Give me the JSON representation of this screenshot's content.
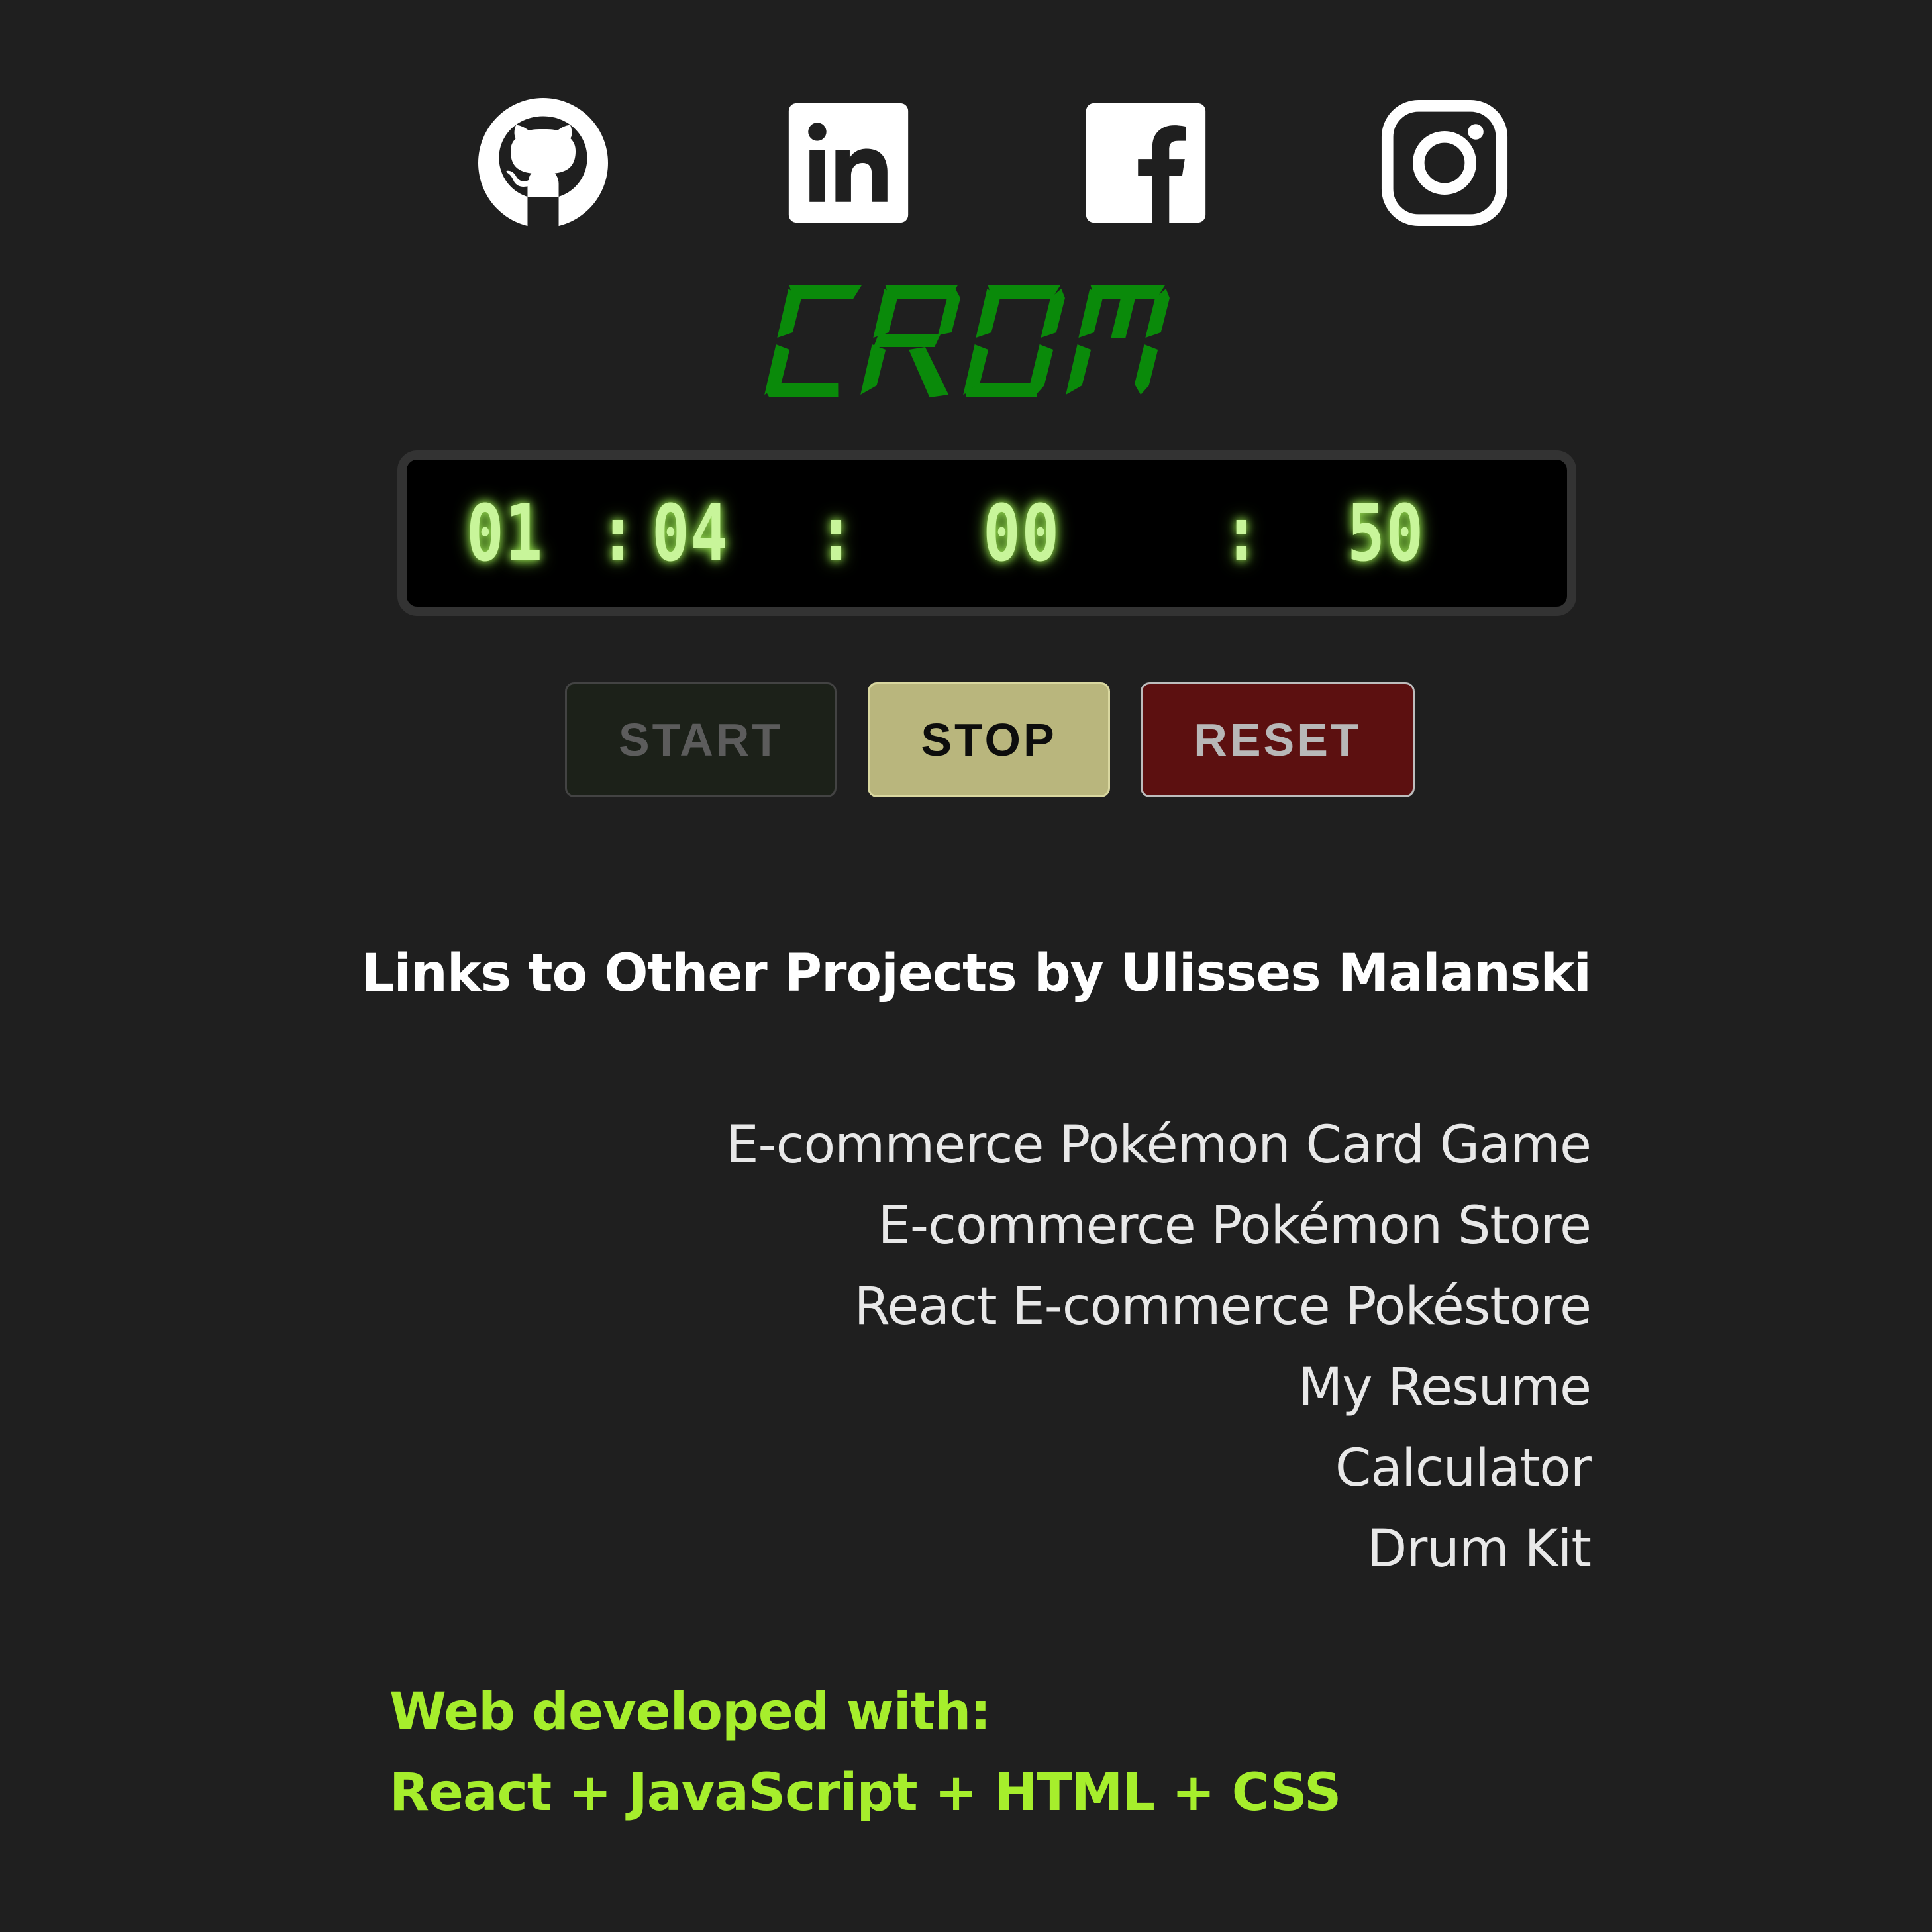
{
  "social": {
    "items": [
      {
        "name": "GitHub",
        "icon": "github-icon"
      },
      {
        "name": "LinkedIn",
        "icon": "linkedin-icon"
      },
      {
        "name": "Facebook",
        "icon": "facebook-icon"
      },
      {
        "name": "Instagram",
        "icon": "instagram-icon"
      }
    ]
  },
  "app": {
    "title": "CRON",
    "title_color": "#0a8a0a"
  },
  "timer": {
    "hours": "01",
    "minutes": "04",
    "seconds": "00",
    "centiseconds": "50",
    "separator": ":",
    "digit_color": "#c8f59a"
  },
  "controls": {
    "start_label": "START",
    "stop_label": "STOP",
    "reset_label": "RESET"
  },
  "links": {
    "heading": "Links to Other Projects by Ulisses Malanski",
    "items": [
      "E-commerce Pokémon Card Game",
      "E-commerce Pokémon Store",
      "React E-commerce Pokéstore",
      "My Resume",
      "Calculator",
      "Drum Kit"
    ]
  },
  "footer": {
    "line1": "Web developed with:",
    "line2": "React + JavaScript + HTML + CSS",
    "color": "#a6ee2c"
  }
}
